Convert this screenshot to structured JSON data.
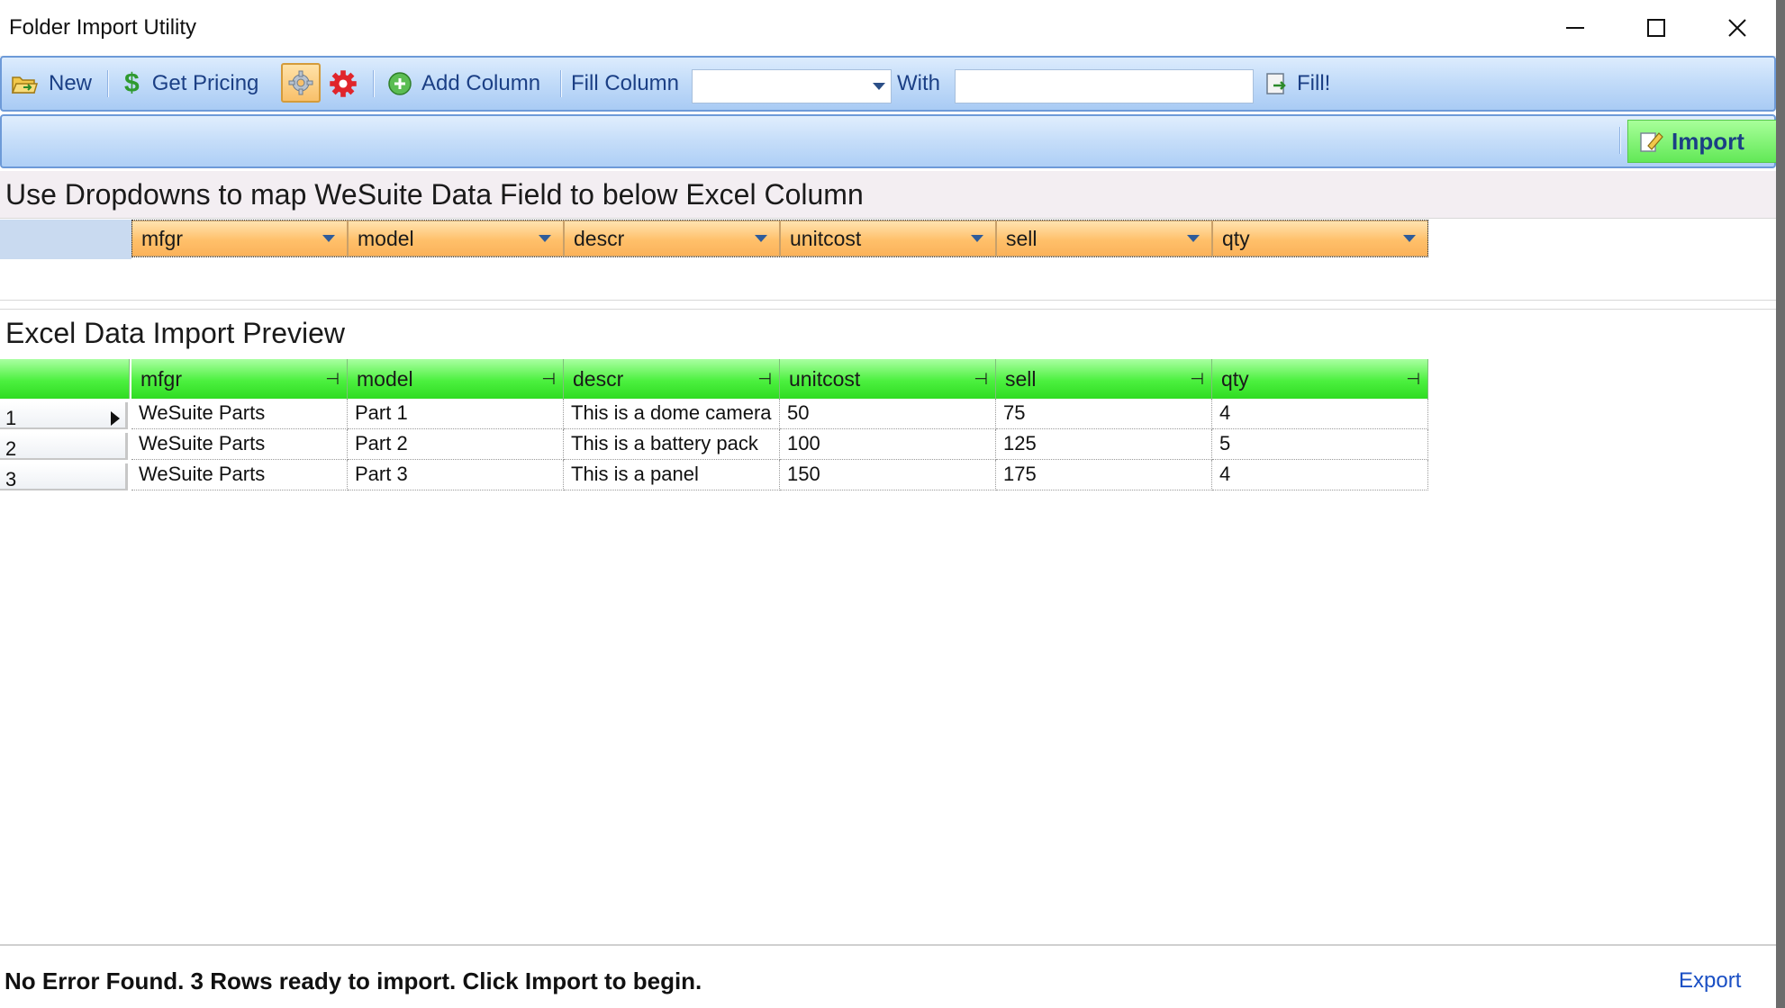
{
  "window": {
    "title": "Folder Import Utility"
  },
  "toolbar": {
    "new_label": "New",
    "get_pricing_label": "Get Pricing",
    "add_column_label": "Add Column",
    "fill_column_label": "Fill Column",
    "fill_column_value": "",
    "with_label": "With",
    "with_value": "",
    "fill_label": "Fill!",
    "import_label": "Import"
  },
  "mapping": {
    "heading": "Use Dropdowns to map WeSuite Data Field to below Excel Column",
    "fields": [
      "mfgr",
      "model",
      "descr",
      "unitcost",
      "sell",
      "qty"
    ]
  },
  "preview": {
    "heading": "Excel Data Import Preview",
    "columns": [
      "mfgr",
      "model",
      "descr",
      "unitcost",
      "sell",
      "qty"
    ],
    "rows": [
      {
        "num": "1",
        "cells": [
          "WeSuite Parts",
          "Part 1",
          "This is a dome camera",
          "50",
          "75",
          "4"
        ]
      },
      {
        "num": "2",
        "cells": [
          "WeSuite Parts",
          "Part 2",
          "This is a battery pack",
          "100",
          "125",
          "5"
        ]
      },
      {
        "num": "3",
        "cells": [
          "WeSuite Parts",
          "Part 3",
          "This is a panel",
          "150",
          "175",
          "4"
        ]
      }
    ]
  },
  "status": {
    "message": "No Error Found. 3 Rows ready to import. Click Import to begin.",
    "export_label": "Export"
  },
  "colors": {
    "mapping_dropdown": "#ffc06a",
    "grid_header": "#4cf03f",
    "import_button": "#62e857",
    "toolbar": "#c3dcf9",
    "link": "#1a4fc4"
  }
}
